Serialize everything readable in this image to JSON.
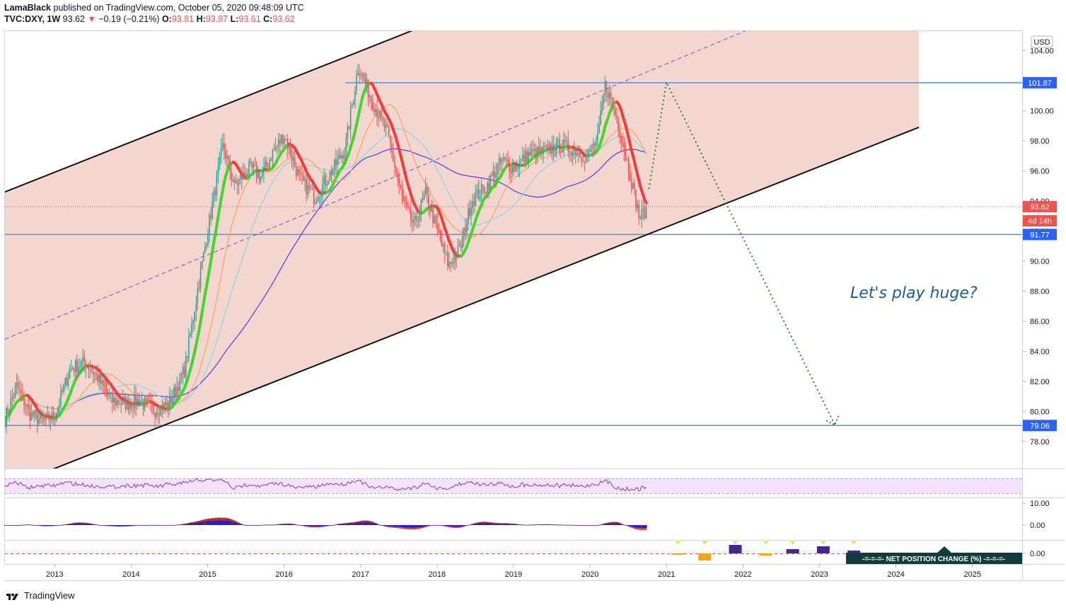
{
  "header": {
    "publisher": "LamaBlack",
    "published_text": "published on TradingView.com, October 05, 2020 09:48:09 UTC",
    "symbol": "TVC:DXY, 1W",
    "last": "93.62",
    "change": "−0.19 (−0.21%)",
    "o_label": "O:",
    "o": "93.81",
    "h_label": "H:",
    "h": "93.87",
    "l_label": "L:",
    "l": "93.61",
    "c_label": "C:",
    "c": "93.62"
  },
  "currency_badge": "USD",
  "annotation": "Let's play huge?",
  "footer_brand": "TradingView",
  "countdown": "4d 14h",
  "cot_label": "-=-=-=- NET POSITION CHANGE (%) -=-=-=-",
  "colors": {
    "channel_fill": "#f3d6d0",
    "level_line": "#5b8fd9",
    "up": "#26a69a",
    "down": "#ef5350",
    "ema_green": "#44d62c",
    "ema_red": "#f23b3b",
    "ma_orange": "#f7a35c",
    "ma_cyan": "#87d7e6",
    "ma_blue": "#4f3fd6",
    "projection": "#2e7d32",
    "rsi_line": "#8e3ba6",
    "rsi_band": "#f3e3fb"
  },
  "chart_data": {
    "type": "candlestick",
    "symbol": "TVC:DXY",
    "interval": "1W",
    "y_axis": {
      "ticks": [
        78,
        80,
        82,
        84,
        86,
        88,
        90,
        92,
        94,
        96,
        98,
        100,
        102,
        104
      ],
      "range": [
        76.2,
        105.3
      ]
    },
    "x_axis": {
      "ticks": [
        "2013",
        "2014",
        "2015",
        "2016",
        "2017",
        "2018",
        "2019",
        "2020",
        "2021",
        "2022",
        "2023",
        "2024",
        "2025"
      ],
      "range": [
        2012.35,
        2025.65
      ]
    },
    "price_path": [
      [
        2012.35,
        79.5
      ],
      [
        2012.5,
        81.7
      ],
      [
        2012.68,
        79.8
      ],
      [
        2012.85,
        79.3
      ],
      [
        2013.0,
        79.7
      ],
      [
        2013.2,
        82.8
      ],
      [
        2013.4,
        83.3
      ],
      [
        2013.55,
        82.3
      ],
      [
        2013.75,
        80.7
      ],
      [
        2013.95,
        80.5
      ],
      [
        2014.1,
        80.7
      ],
      [
        2014.3,
        80.1
      ],
      [
        2014.5,
        80.5
      ],
      [
        2014.7,
        82.8
      ],
      [
        2014.85,
        87.5
      ],
      [
        2015.0,
        92.0
      ],
      [
        2015.2,
        97.7
      ],
      [
        2015.35,
        95.0
      ],
      [
        2015.55,
        96.2
      ],
      [
        2015.7,
        95.6
      ],
      [
        2015.85,
        97.2
      ],
      [
        2016.0,
        98.4
      ],
      [
        2016.2,
        95.5
      ],
      [
        2016.4,
        94.2
      ],
      [
        2016.6,
        95.8
      ],
      [
        2016.8,
        97.5
      ],
      [
        2016.97,
        103.0
      ],
      [
        2017.15,
        100.7
      ],
      [
        2017.35,
        98.5
      ],
      [
        2017.55,
        94.0
      ],
      [
        2017.7,
        92.3
      ],
      [
        2017.85,
        94.5
      ],
      [
        2018.0,
        92.0
      ],
      [
        2018.15,
        89.7
      ],
      [
        2018.3,
        90.8
      ],
      [
        2018.45,
        94.0
      ],
      [
        2018.65,
        95.0
      ],
      [
        2018.85,
        96.7
      ],
      [
        2019.0,
        96.2
      ],
      [
        2019.2,
        97.1
      ],
      [
        2019.4,
        97.3
      ],
      [
        2019.6,
        97.7
      ],
      [
        2019.8,
        97.4
      ],
      [
        2019.95,
        96.9
      ],
      [
        2020.1,
        98.1
      ],
      [
        2020.2,
        101.8
      ],
      [
        2020.35,
        99.5
      ],
      [
        2020.5,
        96.3
      ],
      [
        2020.65,
        92.8
      ],
      [
        2020.75,
        93.62
      ]
    ],
    "channel": {
      "upper": [
        [
          2012.35,
          94.6
        ],
        [
          2015.2,
          100.4
        ],
        [
          2017.0,
          103.8
        ],
        [
          2018.4,
          106.8
        ]
      ],
      "middle_dashed": [
        [
          2012.35,
          84.8
        ],
        [
          2023.3,
          108.0
        ]
      ],
      "lower": [
        [
          2012.9,
          76.0
        ],
        [
          2024.3,
          98.9
        ]
      ],
      "fill_right_x": 2024.3
    },
    "levels": [
      {
        "label": "101.87",
        "value": 101.87
      },
      {
        "label": "91.77",
        "value": 91.77
      },
      {
        "label": "79.06",
        "value": 79.06
      }
    ],
    "last_price": {
      "label": "93.62",
      "value": 93.62
    },
    "projection": [
      [
        2020.77,
        94.8
      ],
      [
        2021.0,
        101.9
      ],
      [
        2023.2,
        79.1
      ]
    ],
    "rsi_range": [
      30,
      70
    ],
    "macd_axis": {
      "ticks": [
        "10.00",
        "0.00"
      ]
    },
    "cot_axis": {
      "ticks": [
        "0.00"
      ]
    }
  }
}
